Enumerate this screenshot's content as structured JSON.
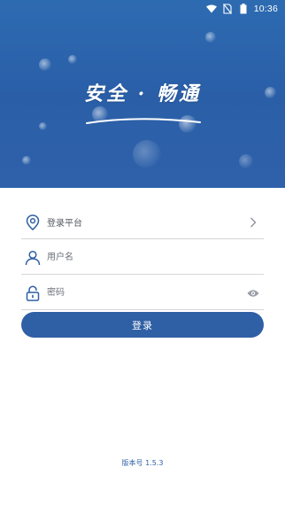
{
  "status_bar": {
    "time": "10:36",
    "icons": [
      "wifi-icon",
      "no-sim-icon",
      "battery-icon"
    ]
  },
  "header": {
    "slogan": "安全 · 畅通"
  },
  "form": {
    "platform": {
      "label": "登录平台",
      "icon": "location-pin-icon",
      "trail_icon": "chevron-right-icon"
    },
    "username": {
      "placeholder": "用户名",
      "icon": "user-icon"
    },
    "password": {
      "placeholder": "密码",
      "icon": "lock-icon",
      "trail_icon": "eye-icon"
    },
    "submit_label": "登录"
  },
  "footer": {
    "version": "版本号 1.5.3"
  },
  "colors": {
    "brand": "#2f5fa4",
    "header_bg": "#2a5fa8",
    "field_text": "#555a63",
    "divider": "#d6d6d6"
  }
}
